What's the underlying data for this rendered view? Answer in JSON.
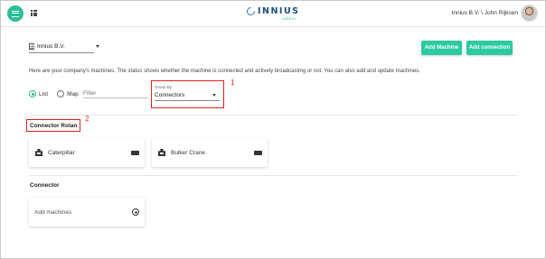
{
  "header": {
    "logo_text": "INNIUS",
    "logo_sub": "Admin",
    "user_name": "Innius B.V. \\ John Rijksen"
  },
  "company": {
    "selected": "Innius B.V."
  },
  "actions": {
    "add_machine": "Add Machine",
    "add_connection": "Add connection"
  },
  "info_text": "Here are your company's machines. The status shows whether the machine is connected and actively broadcasting or not. You can also add and update machines.",
  "view": {
    "options": [
      {
        "label": "List",
        "checked": true
      },
      {
        "label": "Map",
        "checked": false
      }
    ],
    "filter_placeholder": "Filter"
  },
  "group_by": {
    "label": "Group By",
    "value": "Connectors"
  },
  "annotations": {
    "marker_1": "1",
    "marker_2": "2"
  },
  "sections": [
    {
      "title": "Connector  Rolan",
      "machines": [
        {
          "name": "Caterpillar"
        },
        {
          "name": "Bulker Crane"
        }
      ]
    },
    {
      "title": "Connector",
      "add_label": "Add machines"
    }
  ],
  "colors": {
    "accent": "#2bcaa0",
    "highlight_border": "#e02020",
    "brand": "#1f4e79"
  }
}
